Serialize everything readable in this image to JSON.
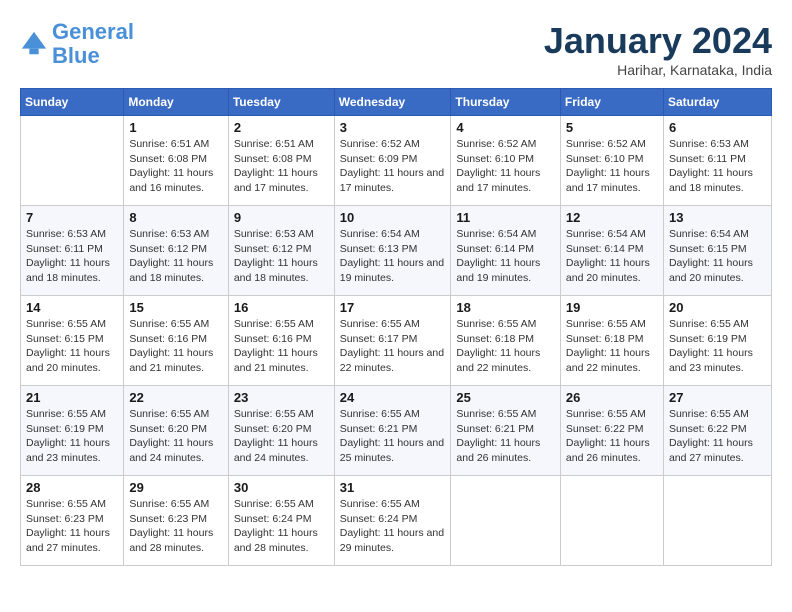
{
  "header": {
    "logo_line1": "General",
    "logo_line2": "Blue",
    "month": "January 2024",
    "location": "Harihar, Karnataka, India"
  },
  "weekdays": [
    "Sunday",
    "Monday",
    "Tuesday",
    "Wednesday",
    "Thursday",
    "Friday",
    "Saturday"
  ],
  "weeks": [
    [
      {
        "day": "",
        "sunrise": "",
        "sunset": "",
        "daylight": ""
      },
      {
        "day": "1",
        "sunrise": "Sunrise: 6:51 AM",
        "sunset": "Sunset: 6:08 PM",
        "daylight": "Daylight: 11 hours and 16 minutes."
      },
      {
        "day": "2",
        "sunrise": "Sunrise: 6:51 AM",
        "sunset": "Sunset: 6:08 PM",
        "daylight": "Daylight: 11 hours and 17 minutes."
      },
      {
        "day": "3",
        "sunrise": "Sunrise: 6:52 AM",
        "sunset": "Sunset: 6:09 PM",
        "daylight": "Daylight: 11 hours and 17 minutes."
      },
      {
        "day": "4",
        "sunrise": "Sunrise: 6:52 AM",
        "sunset": "Sunset: 6:10 PM",
        "daylight": "Daylight: 11 hours and 17 minutes."
      },
      {
        "day": "5",
        "sunrise": "Sunrise: 6:52 AM",
        "sunset": "Sunset: 6:10 PM",
        "daylight": "Daylight: 11 hours and 17 minutes."
      },
      {
        "day": "6",
        "sunrise": "Sunrise: 6:53 AM",
        "sunset": "Sunset: 6:11 PM",
        "daylight": "Daylight: 11 hours and 18 minutes."
      }
    ],
    [
      {
        "day": "7",
        "sunrise": "Sunrise: 6:53 AM",
        "sunset": "Sunset: 6:11 PM",
        "daylight": "Daylight: 11 hours and 18 minutes."
      },
      {
        "day": "8",
        "sunrise": "Sunrise: 6:53 AM",
        "sunset": "Sunset: 6:12 PM",
        "daylight": "Daylight: 11 hours and 18 minutes."
      },
      {
        "day": "9",
        "sunrise": "Sunrise: 6:53 AM",
        "sunset": "Sunset: 6:12 PM",
        "daylight": "Daylight: 11 hours and 18 minutes."
      },
      {
        "day": "10",
        "sunrise": "Sunrise: 6:54 AM",
        "sunset": "Sunset: 6:13 PM",
        "daylight": "Daylight: 11 hours and 19 minutes."
      },
      {
        "day": "11",
        "sunrise": "Sunrise: 6:54 AM",
        "sunset": "Sunset: 6:14 PM",
        "daylight": "Daylight: 11 hours and 19 minutes."
      },
      {
        "day": "12",
        "sunrise": "Sunrise: 6:54 AM",
        "sunset": "Sunset: 6:14 PM",
        "daylight": "Daylight: 11 hours and 20 minutes."
      },
      {
        "day": "13",
        "sunrise": "Sunrise: 6:54 AM",
        "sunset": "Sunset: 6:15 PM",
        "daylight": "Daylight: 11 hours and 20 minutes."
      }
    ],
    [
      {
        "day": "14",
        "sunrise": "Sunrise: 6:55 AM",
        "sunset": "Sunset: 6:15 PM",
        "daylight": "Daylight: 11 hours and 20 minutes."
      },
      {
        "day": "15",
        "sunrise": "Sunrise: 6:55 AM",
        "sunset": "Sunset: 6:16 PM",
        "daylight": "Daylight: 11 hours and 21 minutes."
      },
      {
        "day": "16",
        "sunrise": "Sunrise: 6:55 AM",
        "sunset": "Sunset: 6:16 PM",
        "daylight": "Daylight: 11 hours and 21 minutes."
      },
      {
        "day": "17",
        "sunrise": "Sunrise: 6:55 AM",
        "sunset": "Sunset: 6:17 PM",
        "daylight": "Daylight: 11 hours and 22 minutes."
      },
      {
        "day": "18",
        "sunrise": "Sunrise: 6:55 AM",
        "sunset": "Sunset: 6:18 PM",
        "daylight": "Daylight: 11 hours and 22 minutes."
      },
      {
        "day": "19",
        "sunrise": "Sunrise: 6:55 AM",
        "sunset": "Sunset: 6:18 PM",
        "daylight": "Daylight: 11 hours and 22 minutes."
      },
      {
        "day": "20",
        "sunrise": "Sunrise: 6:55 AM",
        "sunset": "Sunset: 6:19 PM",
        "daylight": "Daylight: 11 hours and 23 minutes."
      }
    ],
    [
      {
        "day": "21",
        "sunrise": "Sunrise: 6:55 AM",
        "sunset": "Sunset: 6:19 PM",
        "daylight": "Daylight: 11 hours and 23 minutes."
      },
      {
        "day": "22",
        "sunrise": "Sunrise: 6:55 AM",
        "sunset": "Sunset: 6:20 PM",
        "daylight": "Daylight: 11 hours and 24 minutes."
      },
      {
        "day": "23",
        "sunrise": "Sunrise: 6:55 AM",
        "sunset": "Sunset: 6:20 PM",
        "daylight": "Daylight: 11 hours and 24 minutes."
      },
      {
        "day": "24",
        "sunrise": "Sunrise: 6:55 AM",
        "sunset": "Sunset: 6:21 PM",
        "daylight": "Daylight: 11 hours and 25 minutes."
      },
      {
        "day": "25",
        "sunrise": "Sunrise: 6:55 AM",
        "sunset": "Sunset: 6:21 PM",
        "daylight": "Daylight: 11 hours and 26 minutes."
      },
      {
        "day": "26",
        "sunrise": "Sunrise: 6:55 AM",
        "sunset": "Sunset: 6:22 PM",
        "daylight": "Daylight: 11 hours and 26 minutes."
      },
      {
        "day": "27",
        "sunrise": "Sunrise: 6:55 AM",
        "sunset": "Sunset: 6:22 PM",
        "daylight": "Daylight: 11 hours and 27 minutes."
      }
    ],
    [
      {
        "day": "28",
        "sunrise": "Sunrise: 6:55 AM",
        "sunset": "Sunset: 6:23 PM",
        "daylight": "Daylight: 11 hours and 27 minutes."
      },
      {
        "day": "29",
        "sunrise": "Sunrise: 6:55 AM",
        "sunset": "Sunset: 6:23 PM",
        "daylight": "Daylight: 11 hours and 28 minutes."
      },
      {
        "day": "30",
        "sunrise": "Sunrise: 6:55 AM",
        "sunset": "Sunset: 6:24 PM",
        "daylight": "Daylight: 11 hours and 28 minutes."
      },
      {
        "day": "31",
        "sunrise": "Sunrise: 6:55 AM",
        "sunset": "Sunset: 6:24 PM",
        "daylight": "Daylight: 11 hours and 29 minutes."
      },
      {
        "day": "",
        "sunrise": "",
        "sunset": "",
        "daylight": ""
      },
      {
        "day": "",
        "sunrise": "",
        "sunset": "",
        "daylight": ""
      },
      {
        "day": "",
        "sunrise": "",
        "sunset": "",
        "daylight": ""
      }
    ]
  ]
}
